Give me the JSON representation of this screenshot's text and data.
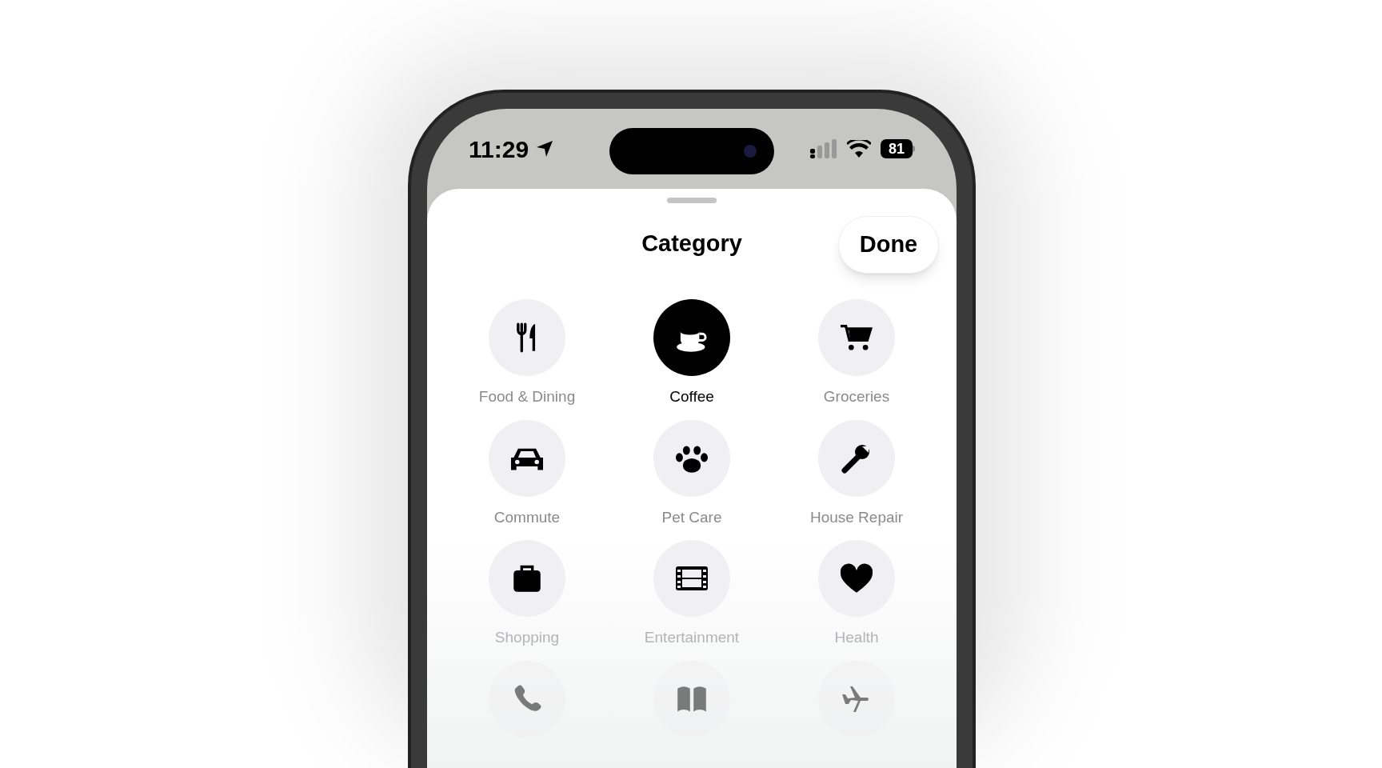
{
  "status_bar": {
    "time": "11:29",
    "battery": "81"
  },
  "sheet": {
    "title": "Category",
    "done_button": "Done"
  },
  "categories": [
    {
      "label": "Food & Dining",
      "selected": false
    },
    {
      "label": "Coffee",
      "selected": true
    },
    {
      "label": "Groceries",
      "selected": false
    },
    {
      "label": "Commute",
      "selected": false
    },
    {
      "label": "Pet Care",
      "selected": false
    },
    {
      "label": "House Repair",
      "selected": false
    },
    {
      "label": "Shopping",
      "selected": false
    },
    {
      "label": "Entertainment",
      "selected": false
    },
    {
      "label": "Health",
      "selected": false
    },
    {
      "selected": false
    },
    {
      "selected": false
    },
    {
      "selected": false
    }
  ]
}
